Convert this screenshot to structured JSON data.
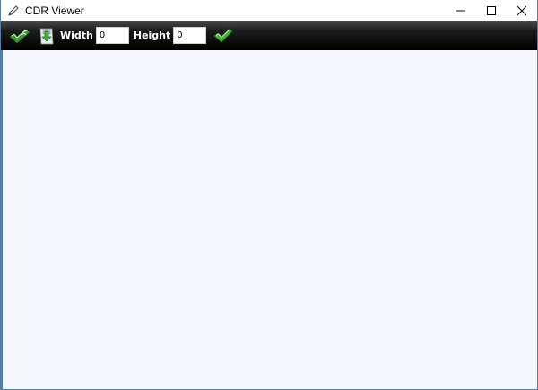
{
  "window": {
    "title": "CDR Viewer",
    "app_icon": "pen-icon",
    "controls": [
      "minimize-icon",
      "maximize-icon",
      "close-icon"
    ]
  },
  "toolbar": {
    "open_icon": "checkmark-open-icon",
    "save_icon": "save-disk-icon",
    "width_label": "Width",
    "width_value": "0",
    "height_label": "Height",
    "height_value": "0",
    "apply_icon": "green-checkmark-icon"
  },
  "colors": {
    "toolbar_bg": "#000000",
    "canvas_bg": "#f5f7fc",
    "accent_green": "#3bb72f"
  }
}
